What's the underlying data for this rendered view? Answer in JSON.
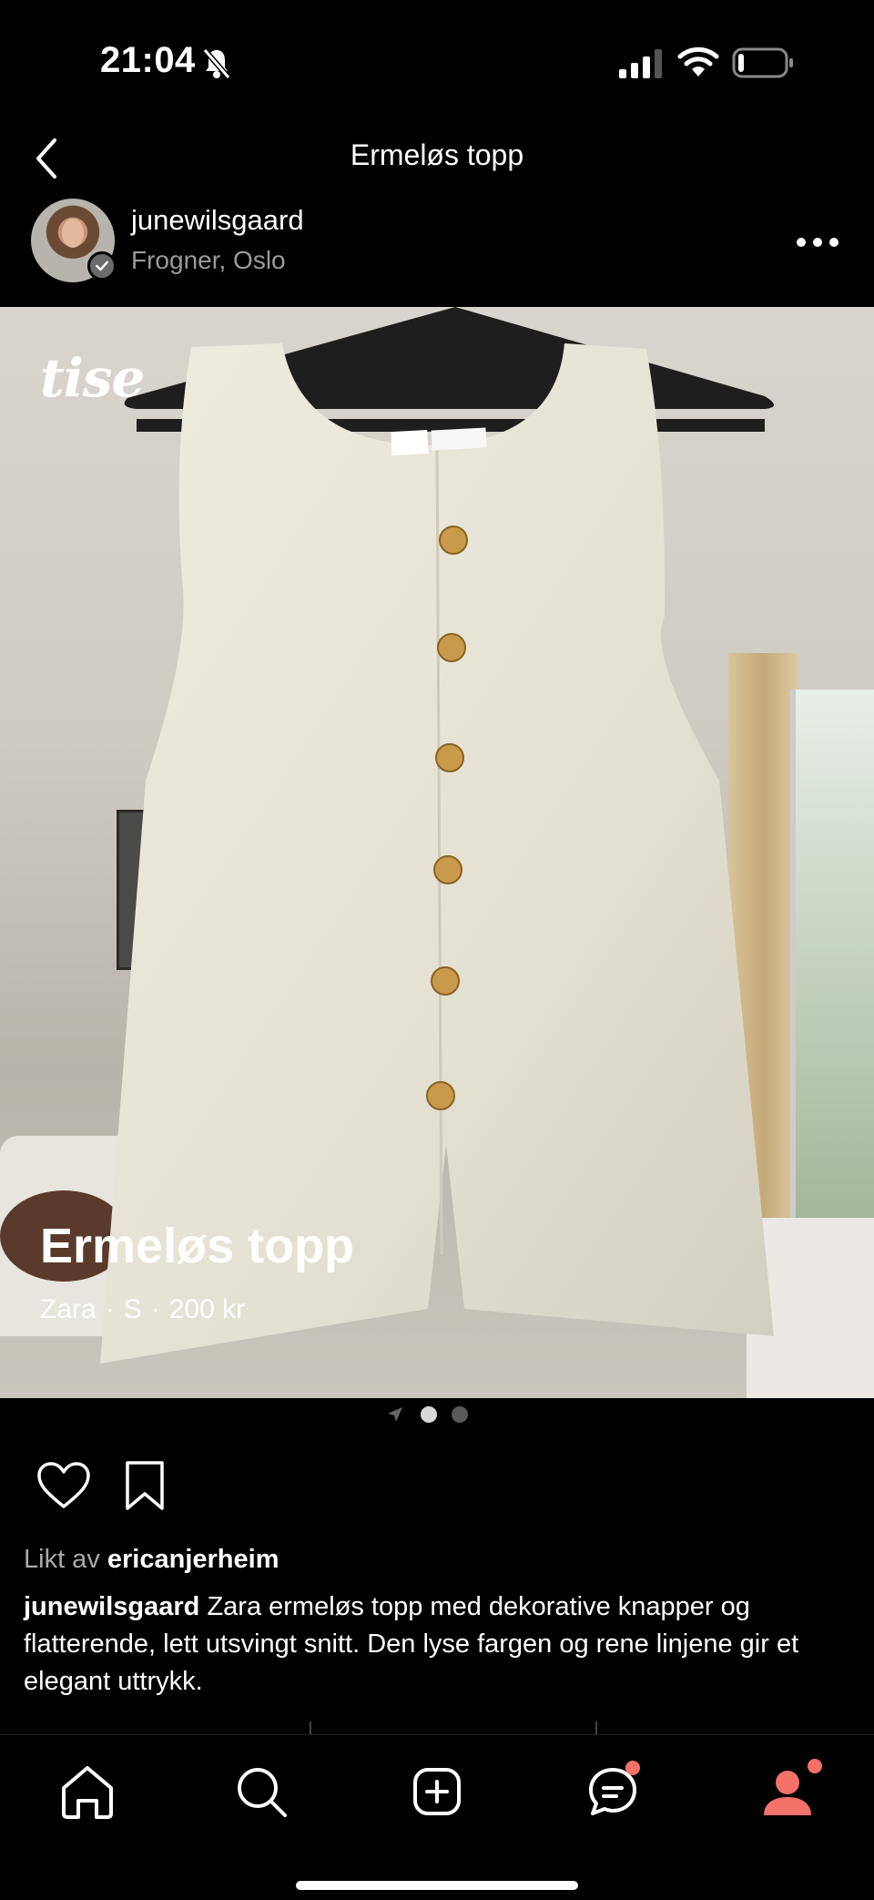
{
  "status_bar": {
    "time": "21:04",
    "icons": [
      "bell-muted-icon",
      "signal-icon",
      "wifi-icon",
      "battery-icon"
    ]
  },
  "header": {
    "title": "Ermeløs topp",
    "back_icon": "chevron-left-icon"
  },
  "seller": {
    "username": "junewilsgaard",
    "location": "Frogner, Oslo",
    "more_icon": "more-horizontal-icon"
  },
  "image": {
    "watermark": "tise",
    "title": "Ermeløs topp",
    "brand": "Zara",
    "size": "S",
    "price": "200 kr",
    "separator": "·"
  },
  "pagination": {
    "total": 2,
    "current": 1
  },
  "actions": {
    "like_icon": "heart-icon",
    "save_icon": "bookmark-icon"
  },
  "likes": {
    "prefix": "Likt av",
    "user": "ericanjerheim"
  },
  "description": {
    "user": "junewilsgaard",
    "text": "Zara ermeløs topp med dekorative knapper og flatterende, lett utsvingt snitt. Den lyse fargen og rene linjene gir et elegant uttrykk."
  },
  "tab_bar": {
    "tabs": [
      {
        "name": "home",
        "icon": "home-icon"
      },
      {
        "name": "search",
        "icon": "search-icon"
      },
      {
        "name": "add",
        "icon": "plus-square-icon"
      },
      {
        "name": "messages",
        "icon": "chat-icon",
        "badge": true
      },
      {
        "name": "profile",
        "icon": "profile-icon",
        "badge": true
      }
    ]
  },
  "colors": {
    "background": "#000000",
    "accent": "#f4726a",
    "muted_text": "#9a9a9a"
  }
}
